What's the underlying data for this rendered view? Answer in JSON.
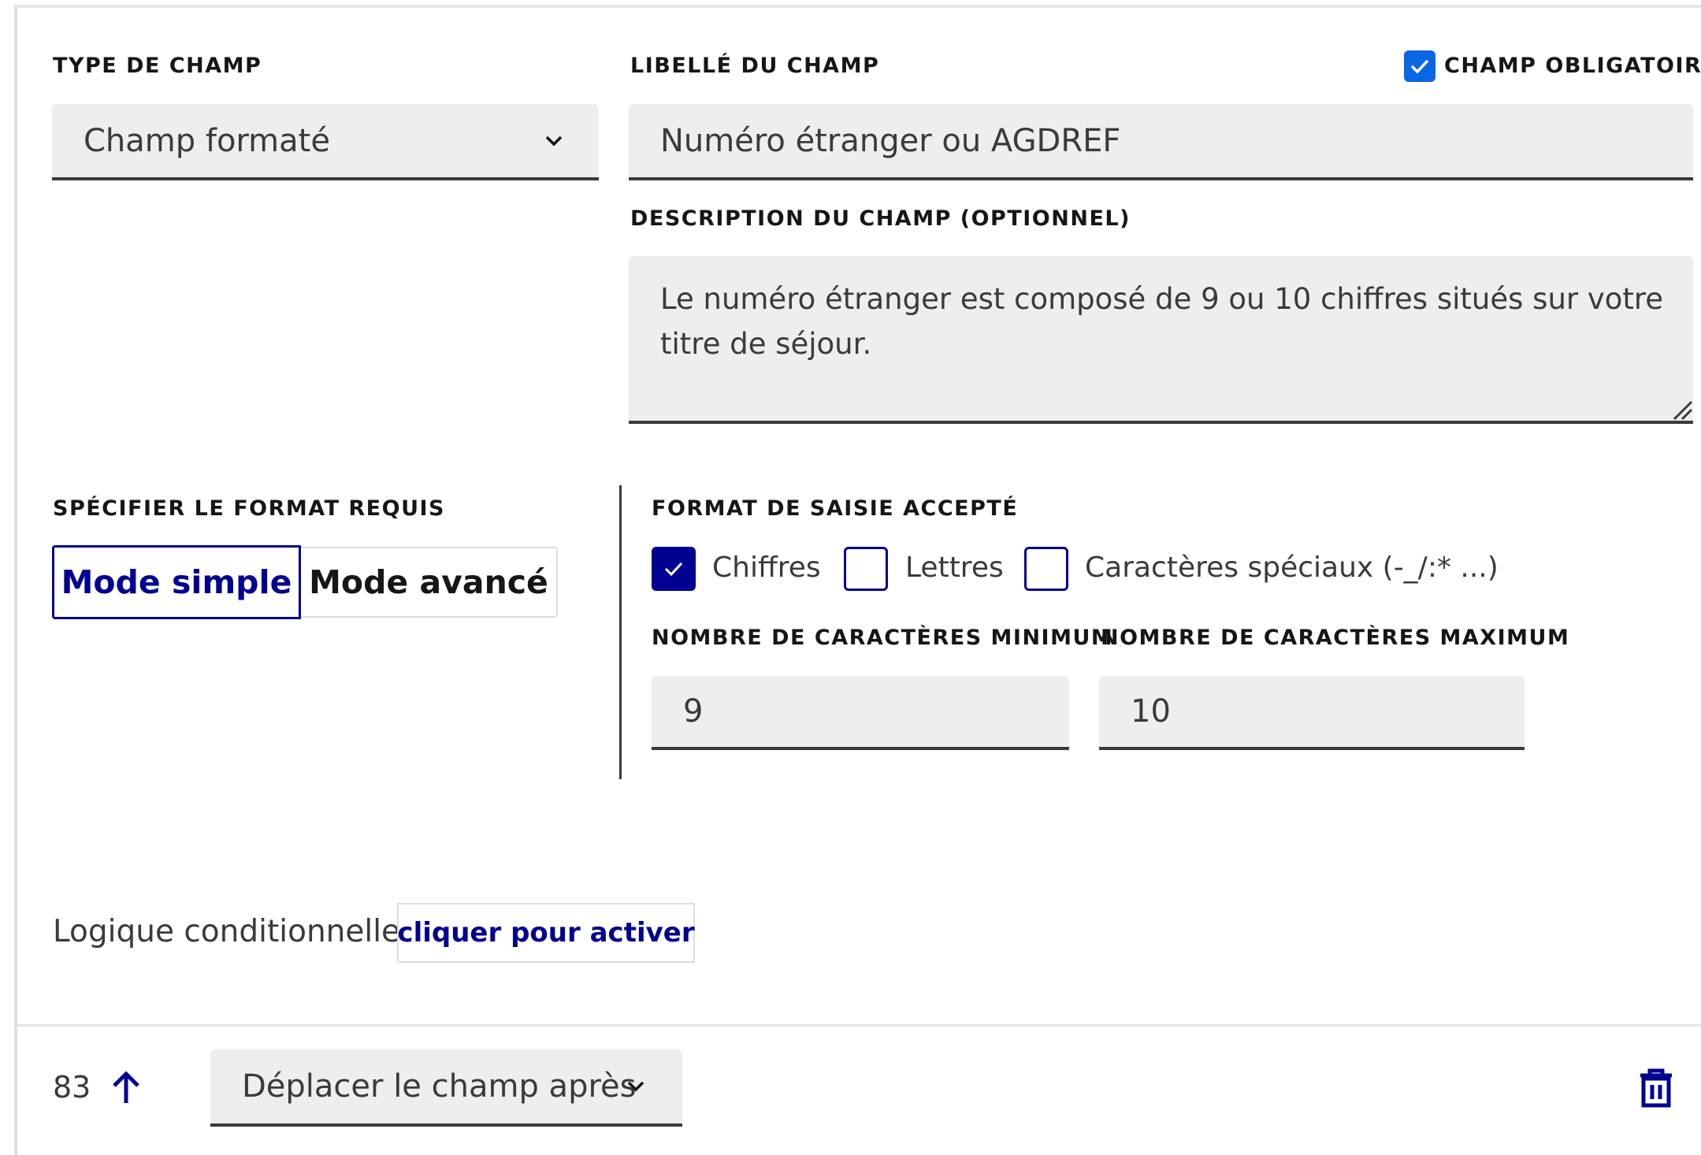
{
  "field_type": {
    "label": "TYPE DE CHAMP",
    "value": "Champ formaté"
  },
  "field_label": {
    "label": "LIBELLÉ DU CHAMP",
    "value": "Numéro étranger ou AGDREF"
  },
  "required": {
    "label": "CHAMP OBLIGATOIRE",
    "checked": true
  },
  "description": {
    "label": "DESCRIPTION DU CHAMP (OPTIONNEL)",
    "line1": "Le numéro étranger est composé de 9 ou 10 chiffres situés sur votre",
    "line2": "titre de séjour."
  },
  "format_mode": {
    "label": "SPÉCIFIER LE FORMAT REQUIS",
    "simple": "Mode simple",
    "advanced": "Mode avancé",
    "selected": "simple"
  },
  "accepted_format": {
    "label": "FORMAT DE SAISIE ACCEPTÉ",
    "options": [
      {
        "label": "Chiffres",
        "checked": true
      },
      {
        "label": "Lettres",
        "checked": false
      },
      {
        "label": "Caractères spéciaux (-_/:* ...)",
        "checked": false
      }
    ]
  },
  "min_chars": {
    "label": "NOMBRE DE CARACTÈRES MINIMUM",
    "value": "9"
  },
  "max_chars": {
    "label": "NOMBRE DE CARACTÈRES MAXIMUM",
    "value": "10"
  },
  "conditional": {
    "label": "Logique conditionnelle",
    "button": "cliquer pour activer"
  },
  "footer": {
    "position": "83",
    "move_label": "Déplacer le champ après"
  },
  "colors": {
    "accent": "#000091",
    "field_bg": "#eeeeee",
    "border_dark": "#3a3a3a"
  },
  "icons": {
    "required_check": "checkmark-icon",
    "select_chevron": "chevron-down-icon",
    "move_up": "arrow-up-icon",
    "delete": "trash-icon"
  }
}
